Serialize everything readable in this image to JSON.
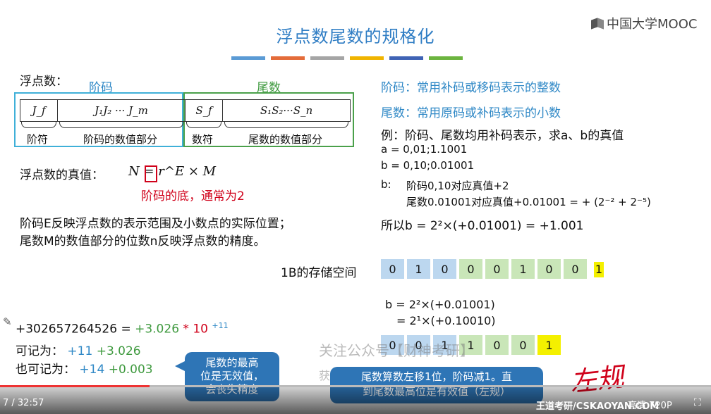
{
  "header": {
    "title": "浮点数尾数的规格化",
    "logo_text": "中国大学MOOC",
    "bar_colors": [
      "#5b9bd5",
      "#e46c3a",
      "#a5a5a5",
      "#f0b400",
      "#3f63b5",
      "#6cb43f"
    ]
  },
  "left": {
    "float_label": "浮点数：",
    "exponent_label": "阶码",
    "mantissa_label": "尾数",
    "fields": [
      "J_f",
      "J₁J₂ ··· J_m",
      "S_f",
      "S₁S₂···S_n"
    ],
    "field_captions": [
      "阶符",
      "阶码的数值部分",
      "数符",
      "尾数的数值部分"
    ],
    "true_value_label": "浮点数的真值：",
    "formula": "N = r^E × M",
    "base_note": "阶码的底，通常为2",
    "desc_line1": "阶码E反映浮点数的表示范围及小数点的实际位置；",
    "desc_line2": "尾数M的数值部分的位数n反映浮点数的精度。"
  },
  "right": {
    "exp_note": "阶码：常用补码或移码表示的整数",
    "man_note": "尾数：常用原码或补码表示的小数",
    "example": "例：阶码、尾数均用补码表示，求a、b的真值",
    "a_line": "a = 0,01;1.1001",
    "b_line": "b = 0,10;0.01001",
    "b_label": "b:",
    "b_exp": "阶码0,10对应真值+2",
    "b_man": "尾数0.01001对应真值+0.01001 = + (2⁻² + 2⁻⁵)",
    "so_line": "所以b = 2²×(+0.01001) = +1.001"
  },
  "storage": {
    "label": "1B的存储空间",
    "bits": [
      "0",
      "1",
      "0",
      "0",
      "0",
      "1",
      "0",
      "0"
    ],
    "extra_bit": "1"
  },
  "normalize": {
    "line1": "b = 2²×(+0.01001)",
    "line2": "= 2¹×(+0.10010)",
    "bits": [
      "0",
      "0",
      "1",
      "1",
      "0",
      "0",
      "1"
    ]
  },
  "annotations": {
    "number_line_left": "+302657264526  =",
    "number_mant": "+3.026",
    "number_star": "*",
    "number_ten": "10",
    "number_exp": "+11",
    "record1_label": "可记为：",
    "record1_exp": "+11",
    "record1_mant": "+3.026",
    "record2_label": "也可记为：",
    "record2_exp": "+14",
    "record2_mant": "+0.003",
    "bubble1": "尾数的最高\n位是无效值，\n会丧失精度",
    "bubble2": "尾数算数左移1位，阶码减1。直\n到尾数最高位是有效值（左规）",
    "handwriting": "左规",
    "watermark": "关注公众号【财神考研】",
    "watermark2": "获",
    "brand": "王道考研/CSKAOYAN.COM"
  },
  "player": {
    "time": "7 / 32:57",
    "quality": "高清 720P",
    "progress": 0.21
  }
}
